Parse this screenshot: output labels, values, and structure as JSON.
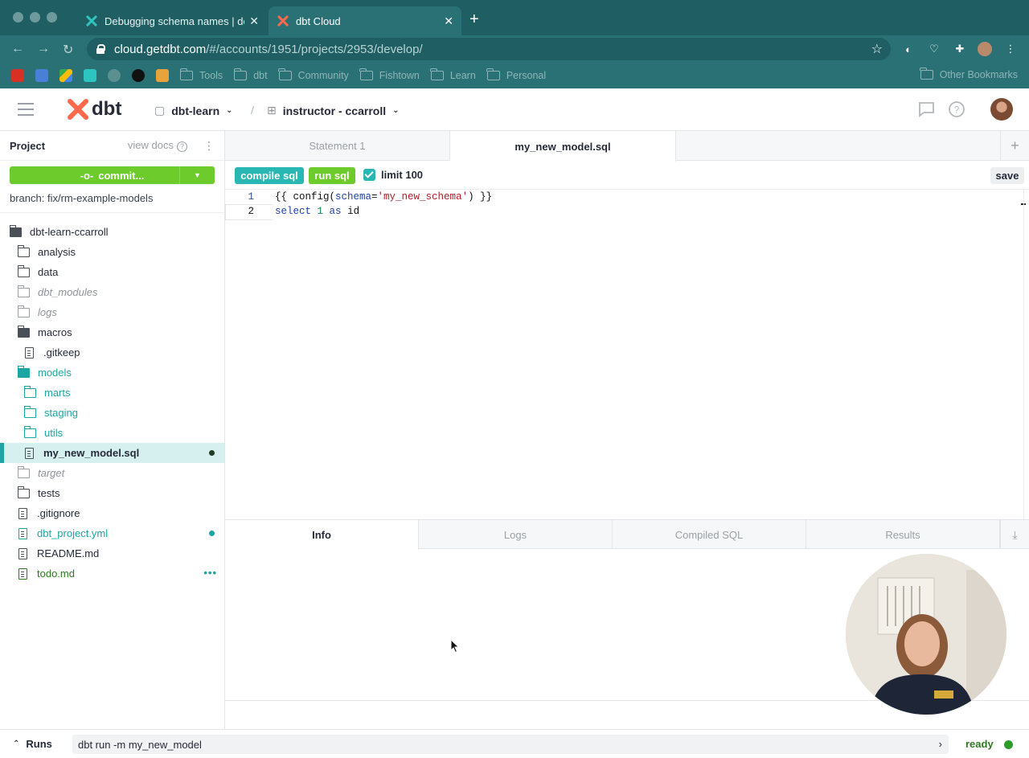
{
  "browser": {
    "tabs": [
      {
        "title": "Debugging schema names | do",
        "active": false
      },
      {
        "title": "dbt Cloud",
        "active": true
      }
    ],
    "url_host": "cloud.getdbt.com",
    "url_path": "/#/accounts/1951/projects/2953/develop/",
    "bookmarks": [
      "Tools",
      "dbt",
      "Community",
      "Fishtown",
      "Learn",
      "Personal"
    ],
    "other_bookmarks": "Other Bookmarks"
  },
  "header": {
    "logo_text": "dbt",
    "project": "dbt-learn",
    "separator": "/",
    "environment": "instructor - ccarroll"
  },
  "sidebar": {
    "title": "Project",
    "view_docs": "view docs",
    "commit_label": "commit...",
    "branch": "branch: fix/rm-example-models",
    "root": "dbt-learn-ccarroll",
    "items": [
      {
        "label": "analysis"
      },
      {
        "label": "data"
      },
      {
        "label": "dbt_modules"
      },
      {
        "label": "logs"
      },
      {
        "label": "macros"
      },
      {
        "label": ".gitkeep"
      },
      {
        "label": "models"
      },
      {
        "label": "marts"
      },
      {
        "label": "staging"
      },
      {
        "label": "utils"
      },
      {
        "label": "my_new_model.sql"
      },
      {
        "label": "target"
      },
      {
        "label": "tests"
      },
      {
        "label": ".gitignore"
      },
      {
        "label": "dbt_project.yml"
      },
      {
        "label": "README.md"
      },
      {
        "label": "todo.md"
      }
    ]
  },
  "editor": {
    "tabs": [
      "Statement 1",
      "my_new_model.sql"
    ],
    "compile_label": "compile sql",
    "run_label": "run sql",
    "limit_label": "limit 100",
    "save_label": "save",
    "lines": [
      {
        "n": "1",
        "p1": "{{ config(",
        "p2": "schema",
        "p3": "=",
        "p4": "'my_new_schema'",
        "p5": ") }}"
      },
      {
        "n": "2",
        "p1": "select",
        "p2": " ",
        "p3": "1",
        "p4": " as ",
        "p5": "id"
      }
    ]
  },
  "bottom_panel": {
    "tabs": [
      "Info",
      "Logs",
      "Compiled SQL",
      "Results"
    ]
  },
  "status": {
    "runs_label": "Runs",
    "command": "dbt run -m my_new_model",
    "state": "ready"
  },
  "colors": {
    "teal": "#1fa4a4",
    "green": "#6dcb2b",
    "brand_orange": "#ff694b"
  }
}
